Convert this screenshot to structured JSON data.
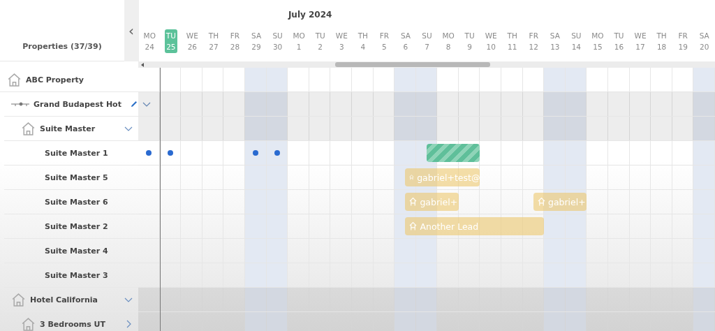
{
  "sidebar": {
    "title": "Properties (37/39)",
    "collapse_button": "‹",
    "items": [
      {
        "kind": "property",
        "name": "ABC Property"
      },
      {
        "kind": "chain",
        "name": "Grand Budapest Hot",
        "editable": true,
        "expanded": true,
        "children": [
          {
            "kind": "unit",
            "name": "Suite Master",
            "expanded": true,
            "children": [
              {
                "kind": "room",
                "name": "Suite Master 1",
                "cells": [
                  {
                    "kind": "dot"
                  },
                  {
                    "kind": "dot"
                  },
                  {
                    "kind": "empty"
                  },
                  {
                    "kind": "empty"
                  },
                  {
                    "kind": "empty"
                  },
                  {
                    "kind": "dot"
                  },
                  {
                    "kind": "dot"
                  },
                  {
                    "kind": "empty"
                  },
                  {
                    "kind": "empty"
                  },
                  {
                    "kind": "empty"
                  },
                  {
                    "kind": "empty"
                  },
                  {
                    "kind": "empty"
                  },
                  {
                    "kind": "empty"
                  },
                  {
                    "kind": "reservation"
                  },
                  {
                    "kind": "reservation"
                  },
                  {
                    "kind": "reservation"
                  },
                  {
                    "kind": "empty"
                  },
                  {
                    "kind": "empty"
                  },
                  {
                    "kind": "empty"
                  },
                  {
                    "kind": "empty"
                  },
                  {
                    "kind": "empty"
                  },
                  {
                    "kind": "empty"
                  },
                  {
                    "kind": "empty"
                  },
                  {
                    "kind": "empty"
                  },
                  {
                    "kind": "empty"
                  },
                  {
                    "kind": "empty"
                  },
                  {
                    "kind": "empty"
                  }
                ],
                "bookings": [
                  {
                    "kind": "reservation"
                  }
                ]
              },
              {
                "kind": "room",
                "name": "Suite Master 5",
                "cells": [
                  {
                    "kind": "empty"
                  },
                  {
                    "kind": "empty"
                  },
                  {
                    "kind": "empty"
                  },
                  {
                    "kind": "empty"
                  },
                  {
                    "kind": "empty"
                  },
                  {
                    "kind": "empty"
                  },
                  {
                    "kind": "empty"
                  },
                  {
                    "kind": "empty"
                  },
                  {
                    "kind": "empty"
                  },
                  {
                    "kind": "empty"
                  },
                  {
                    "kind": "empty"
                  },
                  {
                    "kind": "empty"
                  },
                  {
                    "kind": "lead"
                  },
                  {
                    "kind": "lead"
                  },
                  {
                    "kind": "lead"
                  },
                  {
                    "kind": "lead"
                  },
                  {
                    "kind": "empty"
                  },
                  {
                    "kind": "empty"
                  },
                  {
                    "kind": "empty"
                  },
                  {
                    "kind": "empty"
                  },
                  {
                    "kind": "empty"
                  },
                  {
                    "kind": "empty"
                  },
                  {
                    "kind": "empty"
                  },
                  {
                    "kind": "empty"
                  },
                  {
                    "kind": "empty"
                  },
                  {
                    "kind": "empty"
                  },
                  {
                    "kind": "empty"
                  }
                ],
                "bookings": [
                  {
                    "kind": "lead",
                    "label": "gabriel+test@"
                  }
                ]
              },
              {
                "kind": "room",
                "name": "Suite Master 6",
                "cells": [
                  {
                    "kind": "empty"
                  },
                  {
                    "kind": "empty"
                  },
                  {
                    "kind": "empty"
                  },
                  {
                    "kind": "empty"
                  },
                  {
                    "kind": "empty"
                  },
                  {
                    "kind": "empty"
                  },
                  {
                    "kind": "empty"
                  },
                  {
                    "kind": "empty"
                  },
                  {
                    "kind": "empty"
                  },
                  {
                    "kind": "empty"
                  },
                  {
                    "kind": "empty"
                  },
                  {
                    "kind": "empty"
                  },
                  {
                    "kind": "lead"
                  },
                  {
                    "kind": "lead"
                  },
                  {
                    "kind": "lead"
                  },
                  {
                    "kind": "empty"
                  },
                  {
                    "kind": "empty"
                  },
                  {
                    "kind": "empty"
                  },
                  {
                    "kind": "lead"
                  },
                  {
                    "kind": "lead"
                  },
                  {
                    "kind": "lead"
                  },
                  {
                    "kind": "empty"
                  },
                  {
                    "kind": "empty"
                  },
                  {
                    "kind": "empty"
                  },
                  {
                    "kind": "empty"
                  },
                  {
                    "kind": "empty"
                  },
                  {
                    "kind": "empty"
                  }
                ],
                "bookings": [
                  {
                    "kind": "lead",
                    "label": "gabriel+"
                  },
                  {
                    "kind": "lead",
                    "label": "gabriel+"
                  }
                ]
              },
              {
                "kind": "room",
                "name": "Suite Master 2",
                "cells": [
                  {
                    "kind": "empty"
                  },
                  {
                    "kind": "empty"
                  },
                  {
                    "kind": "empty"
                  },
                  {
                    "kind": "empty"
                  },
                  {
                    "kind": "empty"
                  },
                  {
                    "kind": "empty"
                  },
                  {
                    "kind": "empty"
                  },
                  {
                    "kind": "empty"
                  },
                  {
                    "kind": "empty"
                  },
                  {
                    "kind": "empty"
                  },
                  {
                    "kind": "empty"
                  },
                  {
                    "kind": "empty"
                  },
                  {
                    "kind": "lead"
                  },
                  {
                    "kind": "lead"
                  },
                  {
                    "kind": "lead"
                  },
                  {
                    "kind": "lead"
                  },
                  {
                    "kind": "lead"
                  },
                  {
                    "kind": "lead"
                  },
                  {
                    "kind": "lead"
                  },
                  {
                    "kind": "empty"
                  },
                  {
                    "kind": "empty"
                  },
                  {
                    "kind": "empty"
                  },
                  {
                    "kind": "empty"
                  },
                  {
                    "kind": "empty"
                  },
                  {
                    "kind": "empty"
                  },
                  {
                    "kind": "empty"
                  },
                  {
                    "kind": "empty"
                  }
                ],
                "bookings": [
                  {
                    "kind": "lead",
                    "label": "Another Lead"
                  }
                ]
              },
              {
                "kind": "room",
                "name": "Suite Master 4"
              },
              {
                "kind": "room",
                "name": "Suite Master 3"
              }
            ]
          }
        ]
      },
      {
        "kind": "property",
        "name": "Hotel California",
        "expanded": true,
        "children": [
          {
            "kind": "unit",
            "name": "3 Bedrooms UT",
            "expanded": false
          }
        ]
      }
    ]
  },
  "timeline": {
    "month": "July 2024",
    "days": [
      {
        "weekday": "MO",
        "day": "24",
        "weekend": false,
        "selected": false
      },
      {
        "weekday": "TU",
        "day": "25",
        "weekend": false,
        "selected": true
      },
      {
        "weekday": "WE",
        "day": "26",
        "weekend": false,
        "selected": false
      },
      {
        "weekday": "TH",
        "day": "27",
        "weekend": false,
        "selected": false
      },
      {
        "weekday": "FR",
        "day": "28",
        "weekend": false,
        "selected": false
      },
      {
        "weekday": "SA",
        "day": "29",
        "weekend": true,
        "selected": false
      },
      {
        "weekday": "SU",
        "day": "30",
        "weekend": true,
        "selected": false
      },
      {
        "weekday": "MO",
        "day": "1",
        "weekend": false,
        "selected": false
      },
      {
        "weekday": "TU",
        "day": "2",
        "weekend": false,
        "selected": false
      },
      {
        "weekday": "WE",
        "day": "3",
        "weekend": false,
        "selected": false
      },
      {
        "weekday": "TH",
        "day": "4",
        "weekend": false,
        "selected": false
      },
      {
        "weekday": "FR",
        "day": "5",
        "weekend": false,
        "selected": false
      },
      {
        "weekday": "SA",
        "day": "6",
        "weekend": true,
        "selected": false
      },
      {
        "weekday": "SU",
        "day": "7",
        "weekend": true,
        "selected": false
      },
      {
        "weekday": "MO",
        "day": "8",
        "weekend": false,
        "selected": false
      },
      {
        "weekday": "TU",
        "day": "9",
        "weekend": false,
        "selected": false
      },
      {
        "weekday": "WE",
        "day": "10",
        "weekend": false,
        "selected": false
      },
      {
        "weekday": "TH",
        "day": "11",
        "weekend": false,
        "selected": false
      },
      {
        "weekday": "FR",
        "day": "12",
        "weekend": false,
        "selected": false
      },
      {
        "weekday": "SA",
        "day": "13",
        "weekend": true,
        "selected": false
      },
      {
        "weekday": "SU",
        "day": "14",
        "weekend": true,
        "selected": false
      },
      {
        "weekday": "MO",
        "day": "15",
        "weekend": false,
        "selected": false
      },
      {
        "weekday": "TU",
        "day": "16",
        "weekend": false,
        "selected": false
      },
      {
        "weekday": "WE",
        "day": "17",
        "weekend": false,
        "selected": false
      },
      {
        "weekday": "TH",
        "day": "18",
        "weekend": false,
        "selected": false
      },
      {
        "weekday": "FR",
        "day": "19",
        "weekend": false,
        "selected": false
      },
      {
        "weekday": "SA",
        "day": "20",
        "weekend": true,
        "selected": false
      }
    ]
  }
}
